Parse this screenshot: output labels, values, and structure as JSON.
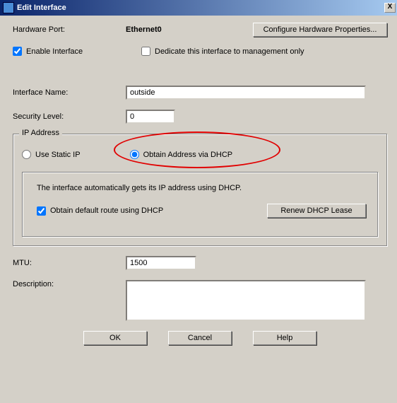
{
  "title": "Edit Interface",
  "hw_port_label": "Hardware Port:",
  "hw_port_value": "Ethernet0",
  "configure_hw_btn": "Configure Hardware Properties...",
  "enable_iface": "Enable Interface",
  "dedicate_mgmt": "Dedicate this interface to management only",
  "iface_name_label": "Interface Name:",
  "iface_name_value": "outside",
  "sec_level_label": "Security Level:",
  "sec_level_value": "0",
  "ip_group_label": "IP Address",
  "use_static": "Use Static IP",
  "obtain_dhcp": "Obtain Address via DHCP",
  "dhcp_info": "The interface automatically gets its IP address using DHCP.",
  "obtain_default_route": "Obtain default route using DHCP",
  "renew_btn": "Renew DHCP Lease",
  "mtu_label": "MTU:",
  "mtu_value": "1500",
  "desc_label": "Description:",
  "desc_value": "",
  "ok_btn": "OK",
  "cancel_btn": "Cancel",
  "help_btn": "Help",
  "close_x": "X"
}
